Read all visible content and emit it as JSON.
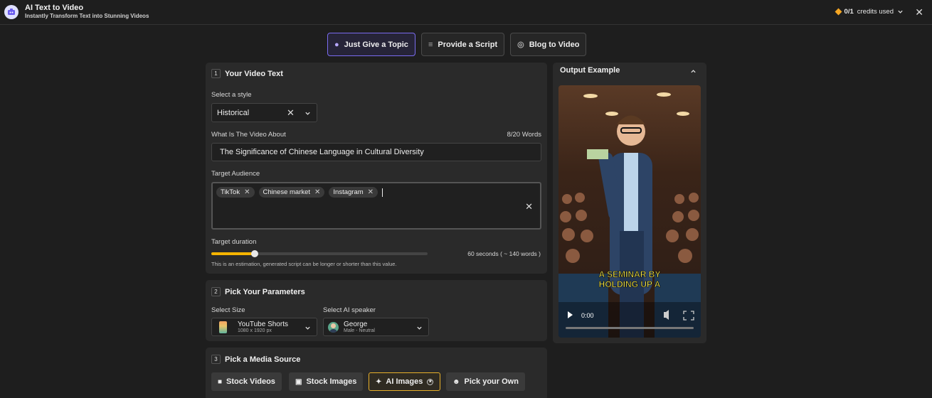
{
  "header": {
    "title": "AI Text to Video",
    "subtitle": "Instantly Transform Text into Stunning Videos",
    "credits_value": "0/1",
    "credits_label": "credits used"
  },
  "tabs": [
    {
      "label": "Just Give a Topic",
      "icon": "lightbulb-icon",
      "active": true
    },
    {
      "label": "Provide a Script",
      "icon": "lines-icon",
      "active": false
    },
    {
      "label": "Blog to Video",
      "icon": "globe-icon",
      "active": false
    }
  ],
  "section1": {
    "number": "1",
    "title": "Your Video Text",
    "style_label": "Select a style",
    "style_value": "Historical",
    "about_label": "What Is The Video About",
    "word_count": "8/20 Words",
    "about_value": "The Significance of Chinese Language in Cultural Diversity",
    "audience_label": "Target Audience",
    "audience_chips": [
      "TikTok",
      "Chinese market",
      "Instagram"
    ],
    "duration_label": "Target duration",
    "duration_value": "60 seconds ( ~ 140 words )",
    "duration_fraction": 0.2,
    "duration_note": "This is an estimation, generated script can be longer or shorter than this value."
  },
  "section2": {
    "number": "2",
    "title": "Pick Your Parameters",
    "size_label": "Select Size",
    "size_value": "YouTube Shorts",
    "size_sub": "1080 x 1920 px",
    "speaker_label": "Select AI speaker",
    "speaker_value": "George",
    "speaker_sub": "Male - Neutral"
  },
  "section3": {
    "number": "3",
    "title": "Pick a Media Source",
    "buttons": [
      {
        "label": "Stock Videos",
        "icon": "video-camera-icon",
        "selected": false
      },
      {
        "label": "Stock Images",
        "icon": "image-icon",
        "selected": false
      },
      {
        "label": "AI Images",
        "icon": "sparkle-icon",
        "selected": true
      },
      {
        "label": "Pick your Own",
        "icon": "user-plus-icon",
        "selected": false
      }
    ]
  },
  "output": {
    "title": "Output Example",
    "caption_line1": "A SEMINAR BY",
    "caption_line2": "HOLDING UP A",
    "time": "0:00"
  },
  "colors": {
    "accent": "#f5b400",
    "active_tab": "#7a6cf0",
    "bg": "#1e1e1e",
    "card": "#2a2a2a"
  }
}
